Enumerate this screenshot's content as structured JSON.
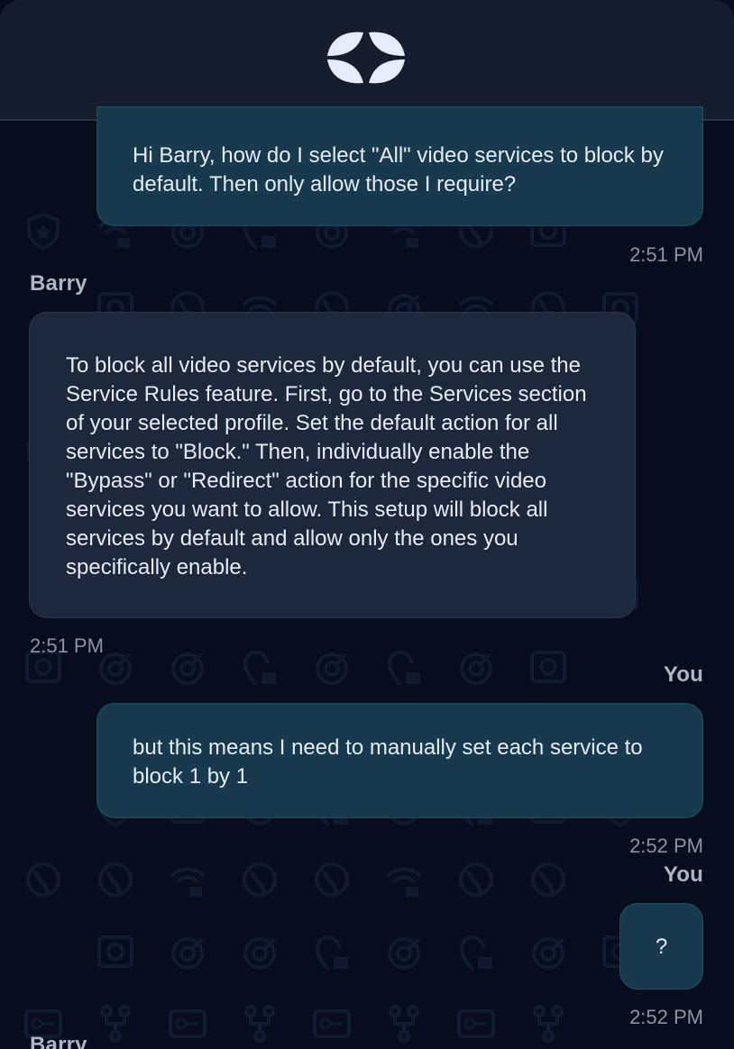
{
  "header": {
    "logo_icon": "four-petal-logo-icon",
    "colors": {
      "header_bg": "#161d2c",
      "logo": "#e7ecfb"
    }
  },
  "colors": {
    "background": "#070d1c",
    "user_bubble": "#173b4d",
    "bot_bubble": "#1e283b",
    "text": "#e6ebf2",
    "muted": "#8a93a3"
  },
  "messages": [
    {
      "role": "user",
      "text": "Hi Barry, how do I select \"All\" video services to block by default. Then only allow those I require?",
      "time": "2:51 PM"
    },
    {
      "role": "bot",
      "sender": "Barry",
      "text": "To block all video services by default, you can use the Service Rules feature. First, go to the Services section of your selected profile. Set the default action for all services to \"Block.\" Then, individually enable the \"Bypass\" or \"Redirect\" action for the specific video services you want to allow. This setup will block all services by default and allow only the ones you specifically enable.",
      "time": "2:51 PM"
    },
    {
      "role": "user",
      "sender": "You",
      "text": "but this means I need to manually set each service to block 1 by 1",
      "time": "2:52 PM"
    },
    {
      "role": "user",
      "sender": "You",
      "text": "?",
      "time": "2:52 PM"
    },
    {
      "role": "bot",
      "sender": "Barry"
    }
  ]
}
